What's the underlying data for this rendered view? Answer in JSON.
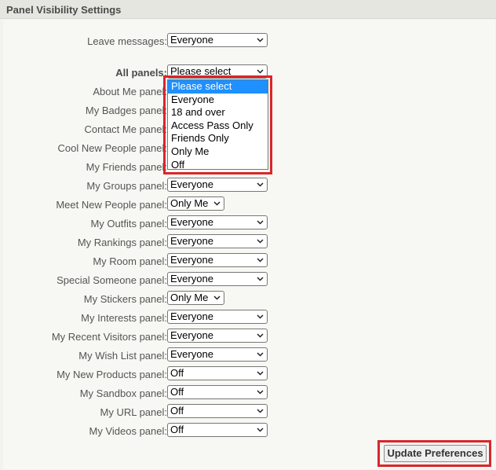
{
  "header": {
    "title": "Panel Visibility Settings"
  },
  "leave_messages": {
    "label": "Leave messages:",
    "value": "Everyone"
  },
  "all_panels": {
    "label": "All panels:",
    "value": "Please select",
    "options": [
      "Please select",
      "Everyone",
      "18 and over",
      "Access Pass Only",
      "Friends Only",
      "Only Me",
      "Off"
    ],
    "highlighted_option": "Please select"
  },
  "hidden_rows": [
    {
      "label": "About Me panel:"
    },
    {
      "label": "My Badges panel:"
    },
    {
      "label": "Contact Me panel:"
    },
    {
      "label": "Cool New People panel:"
    },
    {
      "label": "My Friends panel:"
    }
  ],
  "panels": [
    {
      "label": "My Groups panel:",
      "value": "Everyone"
    },
    {
      "label": "Meet New People panel:",
      "value": "Only Me"
    },
    {
      "label": "My Outfits panel:",
      "value": "Everyone"
    },
    {
      "label": "My Rankings panel:",
      "value": "Everyone"
    },
    {
      "label": "My Room panel:",
      "value": "Everyone"
    },
    {
      "label": "Special Someone panel:",
      "value": "Everyone"
    },
    {
      "label": "My Stickers panel:",
      "value": "Only Me"
    },
    {
      "label": "My Interests panel:",
      "value": "Everyone"
    },
    {
      "label": "My Recent Visitors panel:",
      "value": "Everyone"
    },
    {
      "label": "My Wish List panel:",
      "value": "Everyone"
    },
    {
      "label": "My New Products panel:",
      "value": "Off"
    },
    {
      "label": "My Sandbox panel:",
      "value": "Off"
    },
    {
      "label": "My URL panel:",
      "value": "Off"
    },
    {
      "label": "My Videos panel:",
      "value": "Off"
    }
  ],
  "update_button": {
    "label": "Update Preferences"
  },
  "colors": {
    "highlight": "#d9262b",
    "option_active": "#1e90ff"
  }
}
